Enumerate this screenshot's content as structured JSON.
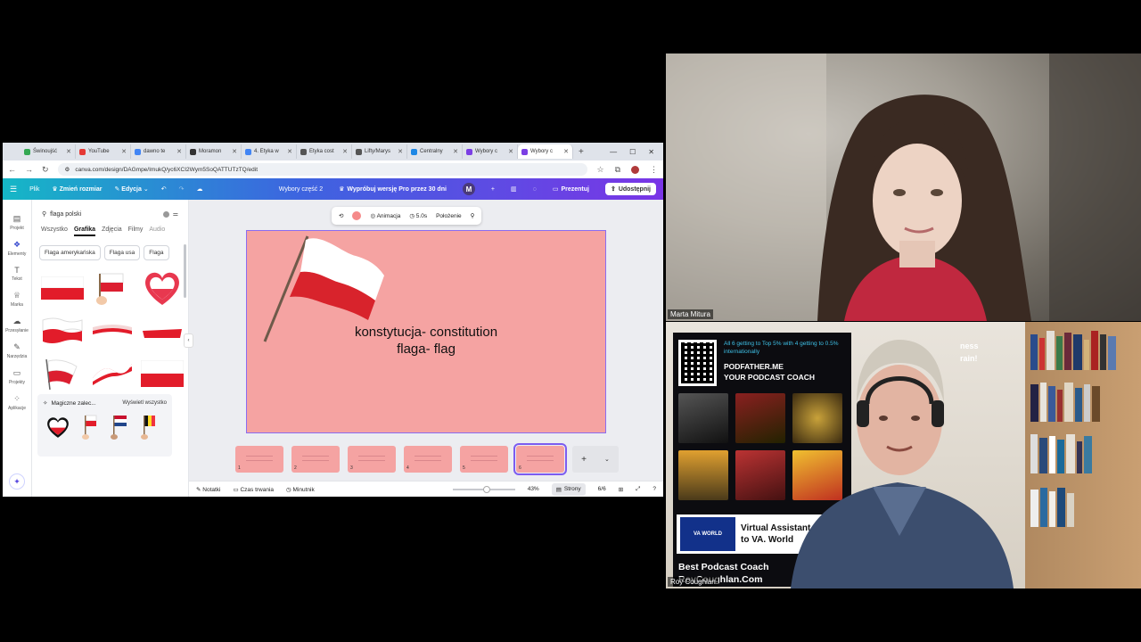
{
  "browser": {
    "tabs": [
      {
        "label": "Świnoujść",
        "color": "#34a853"
      },
      {
        "label": "YouTube",
        "color": "#e53935"
      },
      {
        "label": "dawno te",
        "color": "#4285f4"
      },
      {
        "label": "Moramon",
        "color": "#333333"
      },
      {
        "label": "4. Etyka w",
        "color": "#4285f4"
      },
      {
        "label": "Etyka cost",
        "color": "#555555"
      },
      {
        "label": "Lifty/Marys",
        "color": "#555555"
      },
      {
        "label": "Centralny",
        "color": "#1e88e5"
      },
      {
        "label": "Wybory c",
        "color": "#7b3fe4"
      },
      {
        "label": "Wybory c",
        "color": "#7b3fe4"
      }
    ],
    "url": "canva.com/design/DAGmpe/ImukQ/yc6XCI2Wym5SoQATTUTzTQ/edit"
  },
  "canva": {
    "menu": {
      "file": "Plik",
      "resize": "Zmień rozmiar",
      "edit": "Edycja",
      "doc_title": "Wybory część 2",
      "pro_trial": "Wypróbuj wersję Pro przez 30 dni",
      "avatar_letter": "M",
      "present": "Prezentuj",
      "share": "Udostępnij"
    },
    "rail": [
      "Projekt",
      "Elementy",
      "Tekst",
      "Marka",
      "Przesyłanie",
      "Narzędzia",
      "Projekty",
      "Aplikacje"
    ],
    "panel": {
      "search_value": "flaga polski",
      "tabs": [
        "Wszystko",
        "Grafika",
        "Zdjęcia",
        "Filmy",
        "Audio"
      ],
      "chips": [
        "Flaga amerykańska",
        "Flaga usa",
        "Flaga"
      ],
      "magic_title": "Magiczne zalec...",
      "magic_all": "Wyświetl wszystko"
    },
    "toolbar": {
      "animation": "Animacja",
      "duration": "5.0s",
      "position": "Położenie"
    },
    "slide": {
      "line1": "konstytucja- constitution",
      "line2": "flaga- flag"
    },
    "pages": [
      "1",
      "2",
      "3",
      "4",
      "5",
      "6"
    ],
    "bottom": {
      "notes": "Notatki",
      "duration": "Czas trwania",
      "timer": "Minutnik",
      "zoom": "43%",
      "pages_label": "Strony",
      "page_count": "6/6"
    }
  },
  "video": {
    "top_name": "Marta Mitura",
    "bottom_name": "Roy Coughlan",
    "poster": {
      "small_copy": "All 6 getting to Top 5% with 4 getting to 0.5% internationally",
      "headline_1": "PODFATHER.ME",
      "headline_2": "YOUR PODCAST COACH",
      "va_logo": "VA WORLD",
      "va_line1": "Virtual Assistant",
      "va_line2": "to VA. World",
      "foot_1": "Best Podcast Coach",
      "foot_2": "RoyCoughlan.Com",
      "brain_1": "ness",
      "brain_2": "rain!"
    }
  }
}
